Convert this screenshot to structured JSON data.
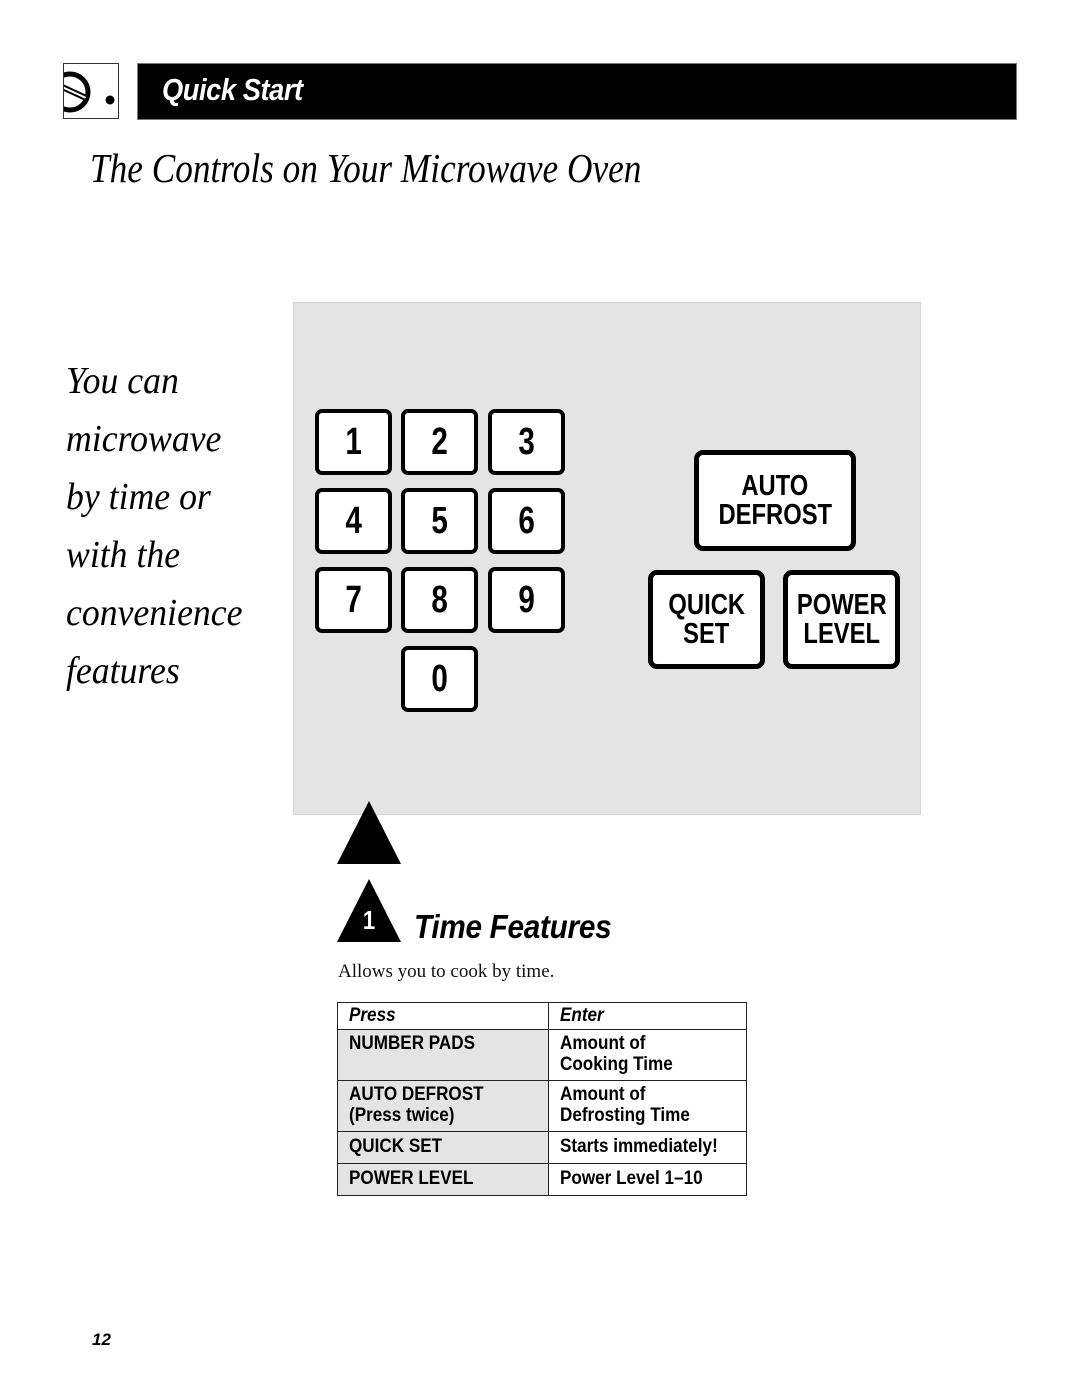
{
  "header": {
    "icon": "microwave-dial-icon",
    "section_label": "Quick Start"
  },
  "page_title": "The Controls on Your Microwave Oven",
  "intro_lines": [
    "You can",
    "microwave",
    "by time or",
    "with the",
    "convenience",
    "features"
  ],
  "control_panel": {
    "number_keys": [
      "1",
      "2",
      "3",
      "4",
      "5",
      "6",
      "7",
      "8",
      "9",
      "0"
    ],
    "auto_defrost": [
      "AUTO",
      "DEFROST"
    ],
    "quick_set": [
      "QUICK",
      "SET"
    ],
    "power_level": [
      "POWER",
      "LEVEL"
    ]
  },
  "feature": {
    "number": "1",
    "title": "Time Features",
    "description": "Allows you to cook by time.",
    "table": {
      "headers": [
        "Press",
        "Enter"
      ],
      "rows": [
        {
          "press": [
            "NUMBER PADS"
          ],
          "enter": [
            "Amount of",
            "Cooking Time"
          ]
        },
        {
          "press": [
            "AUTO DEFROST",
            "(Press twice)"
          ],
          "enter": [
            "Amount of",
            "Defrosting Time"
          ]
        },
        {
          "press": [
            "QUICK SET"
          ],
          "enter": [
            "Starts immediately!"
          ]
        },
        {
          "press": [
            "POWER LEVEL"
          ],
          "enter": [
            "Power Level 1–10"
          ]
        }
      ]
    }
  },
  "page_number": "12"
}
